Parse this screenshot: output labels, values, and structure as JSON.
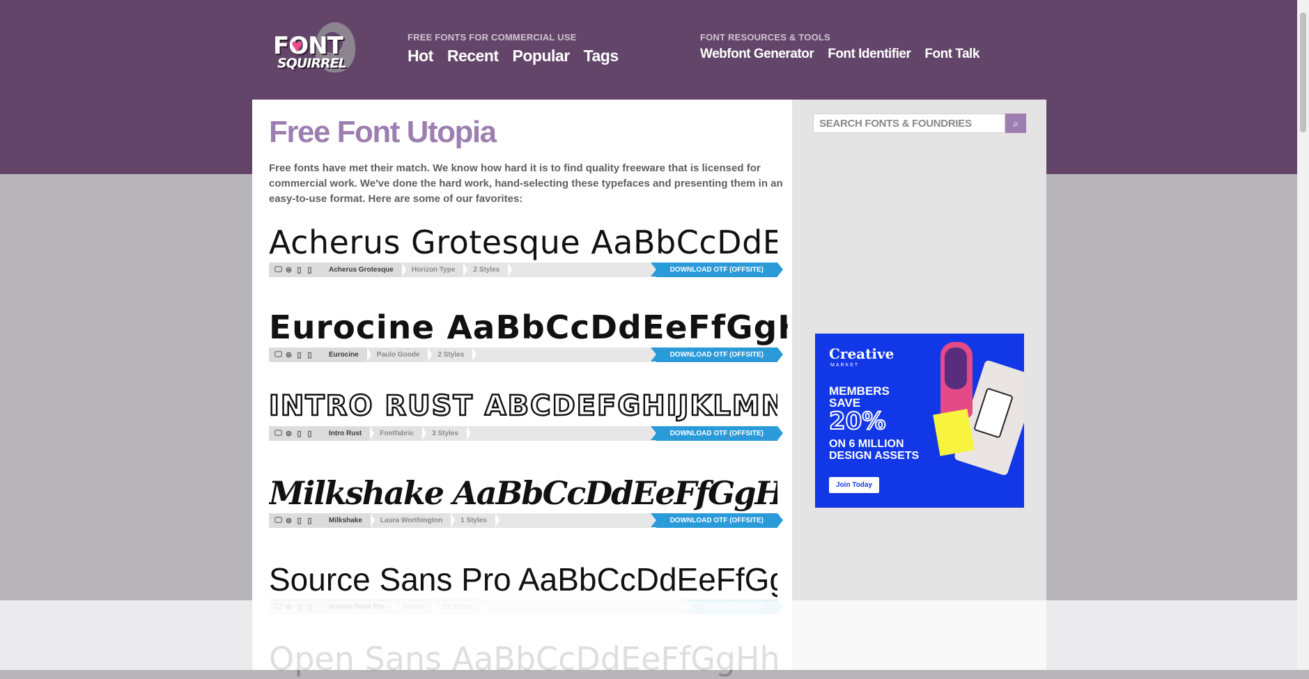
{
  "header": {
    "logo": {
      "line1": "FONT",
      "line2": "SQUIRREL",
      "heart": "♥"
    },
    "nav_left": {
      "title": "FREE FONTS FOR COMMERCIAL USE",
      "links": [
        "Hot",
        "Recent",
        "Popular",
        "Tags"
      ]
    },
    "nav_right": {
      "title": "FONT RESOURCES & TOOLS",
      "links": [
        "Webfont Generator",
        "Font Identifier",
        "Font Talk"
      ]
    }
  },
  "main": {
    "title": "Free Font Utopia",
    "intro": "Free fonts have met their match. We know how hard it is to find quality freeware that is licensed for commercial work. We've done the hard work, hand-selecting these typefaces and presenting them in an easy-to-use format. Here are some of our favorites:",
    "fonts": [
      {
        "sample": "Acherus Grotesque AaBbCcDdE",
        "name": "Acherus Grotesque",
        "foundry": "Horizon Type",
        "styles": "2 Styles",
        "download": "DOWNLOAD OTF (OFFSITE)"
      },
      {
        "sample": "Eurocine AaBbCcDdEeFfGgHh",
        "name": "Eurocine",
        "foundry": "Paulo Goode",
        "styles": "2 Styles",
        "download": "DOWNLOAD OTF (OFFSITE)"
      },
      {
        "sample": "INTRO RUST ABCDEFGHIJKLMN",
        "name": "Intro Rust",
        "foundry": "Fontfabric",
        "styles": "3 Styles",
        "download": "DOWNLOAD OTF (OFFSITE)"
      },
      {
        "sample": "Milkshake AaBbCcDdEeFfGgHhIiJj",
        "name": "Milkshake",
        "foundry": "Laura Worthington",
        "styles": "1 Styles",
        "download": "DOWNLOAD OTF (OFFSITE)"
      },
      {
        "sample": "Source Sans Pro AaBbCcDdEeFfGgHh",
        "name": "Source Sans Pro",
        "foundry": "Adobe",
        "styles": "12 Styles",
        "download": "DOWNLOAD OTF"
      },
      {
        "sample": "Open Sans AaBbCcDdEeFfGgHhIiJj",
        "name": "",
        "foundry": "",
        "styles": "",
        "download": ""
      }
    ]
  },
  "sidebar": {
    "search": {
      "placeholder": "SEARCH FONTS & FOUNDRIES",
      "button": "⌕"
    },
    "ad": {
      "brand": "Creative",
      "brand_sub": "MARKET",
      "headline": "MEMBERS SAVE",
      "percent": "20%",
      "subline": "ON 6 MILLION DESIGN ASSETS",
      "cta": "Join Today",
      "colors": {
        "background": "#1237e6"
      }
    }
  },
  "icons": {
    "desktop": "🖵",
    "web": "⊜",
    "app": "▯",
    "epub": "▯"
  },
  "colors": {
    "header": "#634569",
    "accent": "#9c7fb0",
    "download": "#2a9ad9"
  }
}
